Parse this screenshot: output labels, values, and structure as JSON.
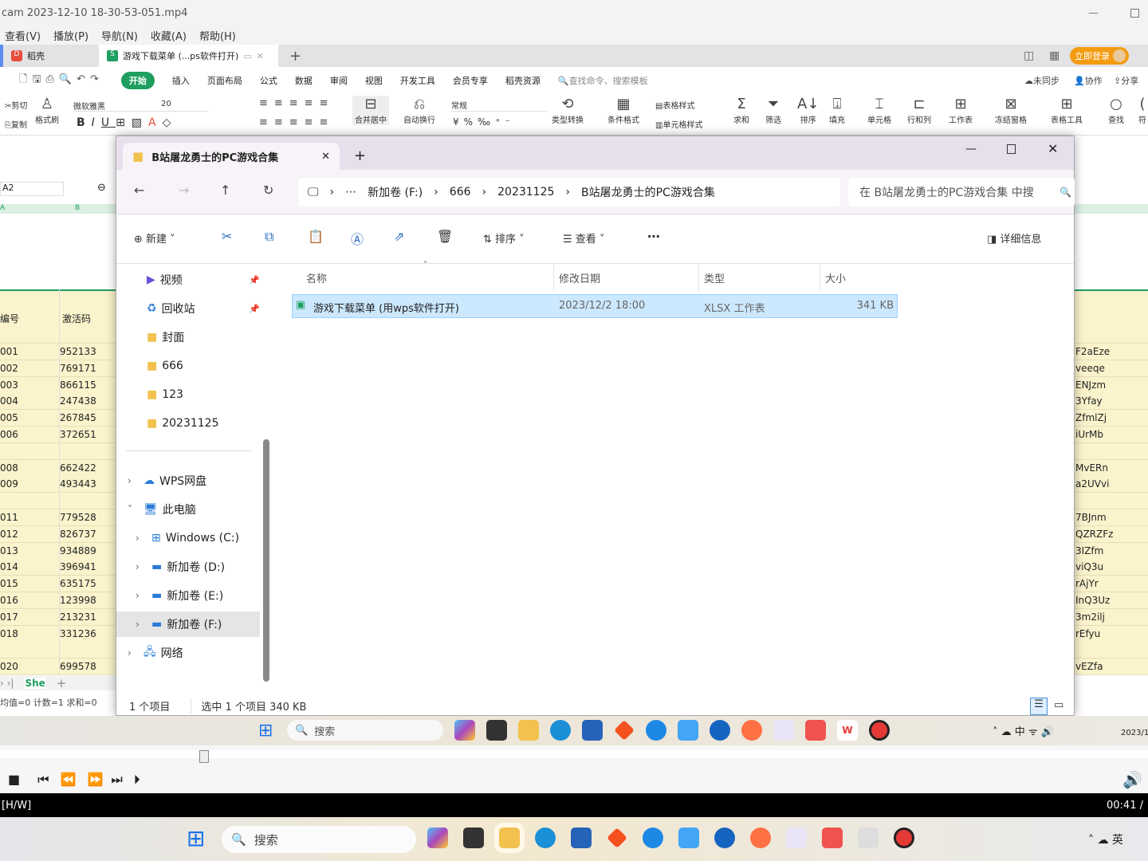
{
  "player": {
    "title": "cam 2023-12-10 18-30-53-051.mp4",
    "menu": [
      "查看(V)",
      "播放(P)",
      "导航(N)",
      "收藏(A)",
      "帮助(H)"
    ],
    "hw": "[H/W]",
    "time": "00:41 /"
  },
  "wps": {
    "tab_home": "稻壳",
    "tab_doc": "游戏下载菜单 (...ps软件打开)",
    "login": "立即登录",
    "ribbon_tabs": [
      "开始",
      "插入",
      "页面布局",
      "公式",
      "数据",
      "审阅",
      "视图",
      "开发工具",
      "会员专享",
      "稻壳资源"
    ],
    "search": "查找命令、搜索模板",
    "sync": "未同步",
    "collab": "协作",
    "share": "分享",
    "tools": {
      "cut": "剪切",
      "copy": "复制",
      "painter": "格式刷",
      "font": "微软雅黑",
      "size": "20",
      "merge": "合并居中",
      "wrap": "自动换行",
      "numfmt": "常规",
      "convert": "类型转换",
      "cond": "条件格式",
      "tablestyle": "表格样式",
      "cellstyle": "单元格样式",
      "sum": "求和",
      "filter": "筛选",
      "sort": "排序",
      "fill": "填充",
      "cell": "单元格",
      "rowcol": "行和列",
      "sheet": "工作表",
      "freeze": "冻结窗格",
      "tabletool": "表格工具",
      "find": "查找",
      "symbol": "符"
    },
    "namebox": "A2",
    "col_a": "A",
    "col_b": "B",
    "headers": [
      "编号",
      "激活码"
    ],
    "rows": [
      [
        "001",
        "952133",
        "F2aEze"
      ],
      [
        "002",
        "769171",
        "veeqe"
      ],
      [
        "003",
        "866115",
        "ENJzm"
      ],
      [
        "004",
        "247438",
        "3Yfay"
      ],
      [
        "005",
        "267845",
        "ZfmlZj"
      ],
      [
        "006",
        "372651",
        "iUrMb"
      ],
      [
        "",
        "",
        ""
      ],
      [
        "008",
        "662422",
        "MvERn"
      ],
      [
        "009",
        "493443",
        "a2UVvi"
      ],
      [
        "",
        "",
        ""
      ],
      [
        "011",
        "779528",
        "7BJnm"
      ],
      [
        "012",
        "826737",
        "QZRZFz"
      ],
      [
        "013",
        "934889",
        "3IZfm"
      ],
      [
        "014",
        "396941",
        "viQ3u"
      ],
      [
        "015",
        "635175",
        "rAjYr"
      ],
      [
        "016",
        "123998",
        "InQ3Uz"
      ],
      [
        "017",
        "213231",
        "3m2ilj"
      ],
      [
        "018",
        "331236",
        "rEfyu"
      ],
      [
        "",
        "",
        ""
      ],
      [
        "020",
        "699578",
        "vEZfa"
      ]
    ],
    "sheet_tab": "She",
    "statusbar": "均值=0 计数=1 求和=0"
  },
  "explorer": {
    "tab_title": "B站屠龙勇士的PC游戏合集",
    "breadcrumb": [
      "新加卷 (F:)",
      "666",
      "20231125",
      "B站屠龙勇士的PC游戏合集"
    ],
    "search_placeholder": "在 B站屠龙勇士的PC游戏合集 中搜",
    "toolbar": {
      "new": "新建",
      "sort": "排序",
      "view": "查看",
      "details": "详细信息"
    },
    "nav": [
      {
        "label": "视频",
        "pin": true
      },
      {
        "label": "回收站",
        "pin": true
      },
      {
        "label": "封面"
      },
      {
        "label": "666"
      },
      {
        "label": "123"
      },
      {
        "label": "20231125"
      }
    ],
    "tree": [
      {
        "label": "WPS网盘",
        "chevron": ">"
      },
      {
        "label": "此电脑",
        "chevron": "v"
      },
      {
        "label": "Windows (C:)",
        "chevron": ">"
      },
      {
        "label": "新加卷 (D:)",
        "chevron": ">"
      },
      {
        "label": "新加卷 (E:)",
        "chevron": ">"
      },
      {
        "label": "新加卷 (F:)",
        "chevron": ">",
        "selected": true
      },
      {
        "label": "网络",
        "chevron": ">"
      }
    ],
    "columns": [
      "名称",
      "修改日期",
      "类型",
      "大小"
    ],
    "files": [
      {
        "name": "游戏下载菜单 (用wps软件打开)",
        "date": "2023/12/2 18:00",
        "type": "XLSX 工作表",
        "size": "341 KB",
        "selected": true
      }
    ],
    "status_count": "1 个项目",
    "status_selected": "选中 1 个项目  340 KB"
  },
  "taskbar": {
    "search": "搜索",
    "tray_lang": "中",
    "date_partial": "2023/1"
  },
  "colors": {
    "accent_green": "#1e9e5f",
    "login_orange": "#f39c12",
    "selection_blue": "#cce8ff",
    "row_yellow": "#fbf3cc"
  }
}
